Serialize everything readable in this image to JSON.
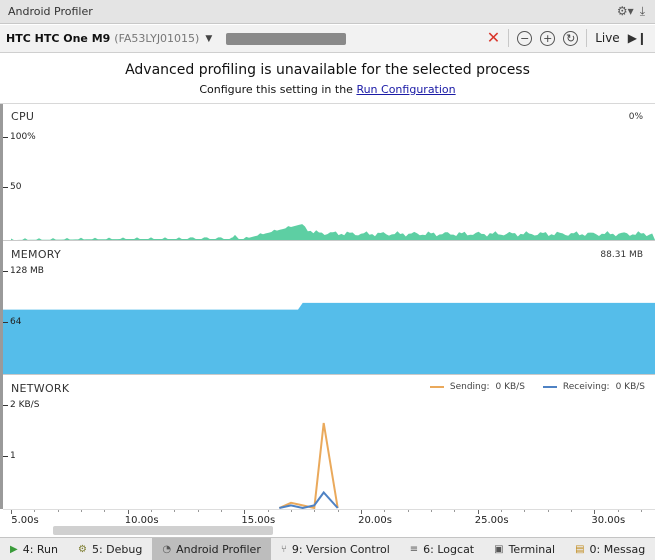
{
  "window": {
    "title": "Android Profiler"
  },
  "titlebar_icons": [
    "gear-icon",
    "download-icon"
  ],
  "device": {
    "name": "HTC HTC One M9",
    "serial": "(FA53LYJ01015)"
  },
  "controls": {
    "live_label": "Live"
  },
  "banner": {
    "message": "Advanced profiling is unavailable for the selected process",
    "sub_prefix": "Configure this setting in the ",
    "link": "Run Configuration"
  },
  "cpu": {
    "title": "CPU",
    "value": "0%",
    "y_top": "100%",
    "y_mid": "50"
  },
  "memory": {
    "title": "MEMORY",
    "value": "88.31 MB",
    "y_top": "128 MB",
    "y_mid": "64"
  },
  "network": {
    "title": "NETWORK",
    "y_top": "2 KB/S",
    "y_mid": "1",
    "sending_label": "Sending:",
    "sending_value": "0 KB/S",
    "receiving_label": "Receiving:",
    "receiving_value": "0 KB/S"
  },
  "colors": {
    "cpu": "#5dcfa3",
    "memory": "#55bdea",
    "sending": "#eaa95b",
    "receiving": "#4e82c4"
  },
  "timeline": {
    "ticks": [
      "5.00s",
      "10.00s",
      "15.00s",
      "20.00s",
      "25.00s",
      "30.00s"
    ]
  },
  "chart_data": [
    {
      "type": "area",
      "title": "CPU",
      "ylabel": "",
      "ylim": [
        0,
        100
      ],
      "x": [
        5.0,
        10.0,
        15.0,
        17.4,
        18.0,
        20.0,
        25.0,
        30.0,
        32.0
      ],
      "series": [
        {
          "name": "CPU",
          "values": [
            0,
            1,
            1,
            15,
            7,
            6,
            6,
            6,
            6
          ]
        }
      ]
    },
    {
      "type": "area",
      "title": "MEMORY",
      "ylabel": "",
      "ylim": [
        0,
        128
      ],
      "x": [
        5.0,
        17.3,
        17.5,
        32.0
      ],
      "series": [
        {
          "name": "MEMORY",
          "values": [
            80,
            80,
            88.31,
            88.31
          ]
        }
      ]
    },
    {
      "type": "line",
      "title": "NETWORK",
      "ylabel": "",
      "ylim": [
        0,
        2
      ],
      "x": [
        16.5,
        17.0,
        17.5,
        18.0,
        18.4,
        19.0
      ],
      "series": [
        {
          "name": "Sending",
          "values": [
            0,
            0.1,
            0.05,
            0.0,
            1.65,
            0.0
          ]
        },
        {
          "name": "Receiving",
          "values": [
            0,
            0.05,
            0.0,
            0.05,
            0.3,
            0.0
          ]
        }
      ]
    }
  ],
  "statusbar": [
    {
      "label": "4: Run",
      "icon": "run-icon"
    },
    {
      "label": "5: Debug",
      "icon": "debug-icon"
    },
    {
      "label": "Android Profiler",
      "icon": "profiler-icon",
      "active": true
    },
    {
      "label": "9: Version Control",
      "icon": "vcs-icon"
    },
    {
      "label": "6: Logcat",
      "icon": "logcat-icon"
    },
    {
      "label": "Terminal",
      "icon": "terminal-icon"
    },
    {
      "label": "0: Messag",
      "icon": "messages-icon"
    }
  ]
}
